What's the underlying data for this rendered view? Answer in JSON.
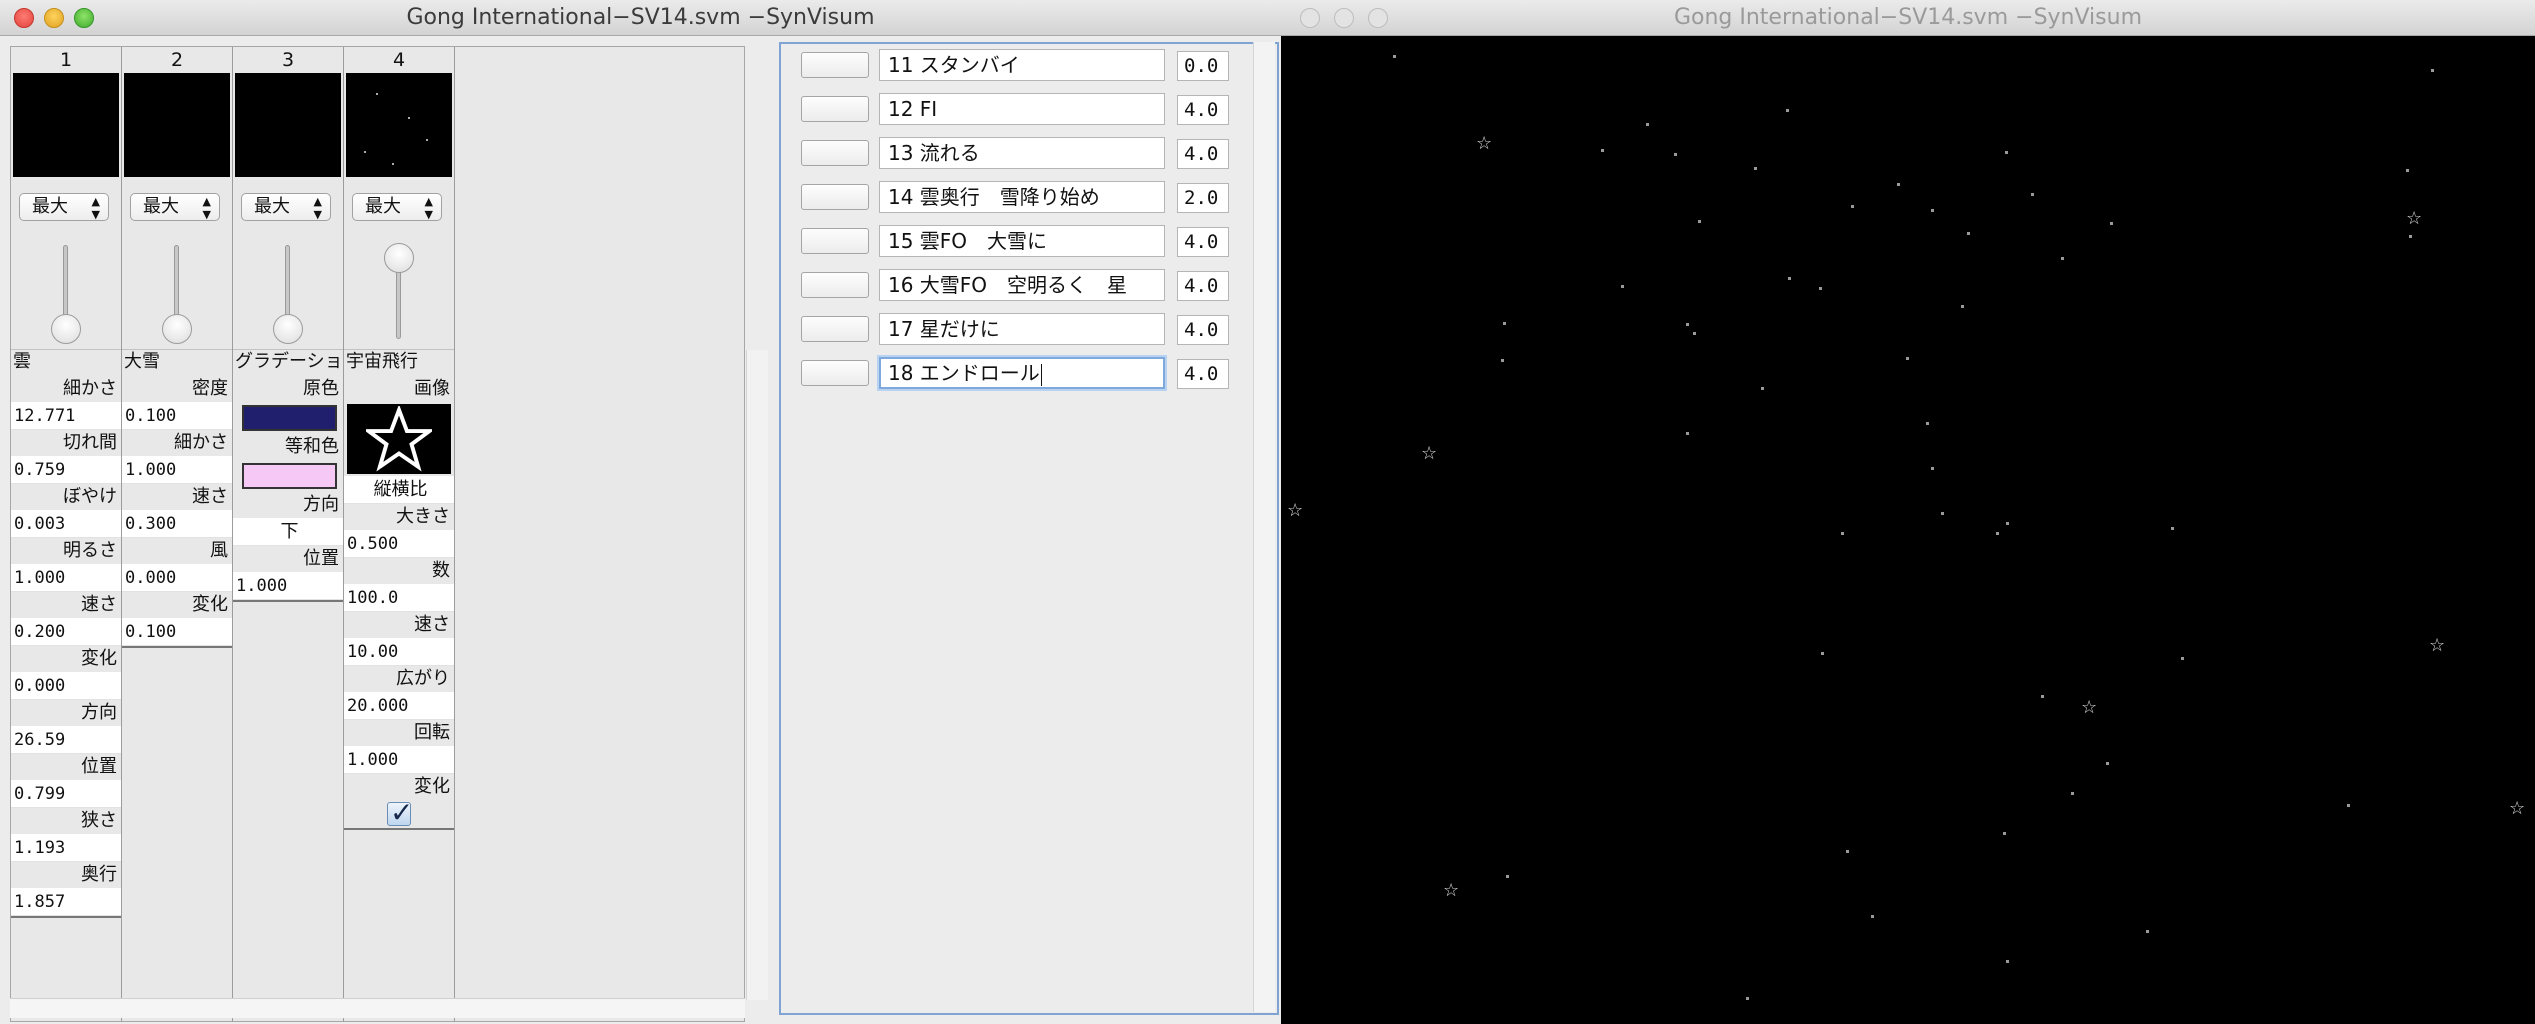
{
  "window_left": {
    "title": "Gong International−SV14.svm −SynVisum"
  },
  "window_right": {
    "title": "Gong International−SV14.svm −SynVisum"
  },
  "layers": [
    {
      "number": "1",
      "mode": "最大",
      "slider_value": 0.0,
      "name": "雲",
      "params": [
        {
          "label": "細かさ",
          "value": "12.771"
        },
        {
          "label": "切れ間",
          "value": "0.759"
        },
        {
          "label": "ぼやけ",
          "value": "0.003"
        },
        {
          "label": "明るさ",
          "value": "1.000"
        },
        {
          "label": "速さ",
          "value": "0.200"
        },
        {
          "label": "変化",
          "value": "0.000"
        },
        {
          "label": "方向",
          "value": "26.59"
        },
        {
          "label": "位置",
          "value": "0.799"
        },
        {
          "label": "狭さ",
          "value": "1.193"
        },
        {
          "label": "奥行",
          "value": "1.857"
        }
      ]
    },
    {
      "number": "2",
      "mode": "最大",
      "slider_value": 0.0,
      "name": "大雪",
      "params": [
        {
          "label": "密度",
          "value": "0.100"
        },
        {
          "label": "細かさ",
          "value": "1.000"
        },
        {
          "label": "速さ",
          "value": "0.300"
        },
        {
          "label": "風",
          "value": "0.000"
        },
        {
          "label": "変化",
          "value": "0.100"
        }
      ]
    },
    {
      "number": "3",
      "mode": "最大",
      "slider_value": 0.0,
      "name": "グラデーショ",
      "params": [
        {
          "label": "原色",
          "color": "#1f1f6e"
        },
        {
          "label": "等和色",
          "color": "#f5c8f5"
        },
        {
          "label": "方向",
          "value": "下"
        },
        {
          "label": "位置",
          "value": "1.000"
        }
      ]
    },
    {
      "number": "4",
      "mode": "最大",
      "slider_value": 1.0,
      "name": "宇宙飛行",
      "image_label": "画像",
      "image_icon": "star-icon",
      "aspect_label": "縦横比",
      "params": [
        {
          "label": "大きさ",
          "value": "0.500"
        },
        {
          "label": "数",
          "value": "100.0"
        },
        {
          "label": "速さ",
          "value": "10.00"
        },
        {
          "label": "広がり",
          "value": "20.000"
        },
        {
          "label": "回転",
          "value": "1.000"
        }
      ],
      "change_label": "変化",
      "change_checked": true
    }
  ],
  "cues": [
    {
      "name": "11 スタンバイ",
      "time": "0.0"
    },
    {
      "name": "12 FI",
      "time": "4.0"
    },
    {
      "name": "13 流れる",
      "time": "4.0"
    },
    {
      "name": "14 雲奥行　雪降り始め",
      "time": "2.0"
    },
    {
      "name": "15 雲FO　大雪に",
      "time": "4.0"
    },
    {
      "name": "16 大雪FO　空明るく　星",
      "time": "4.0"
    },
    {
      "name": "17 星だけに",
      "time": "4.0"
    },
    {
      "name": "18 エンドロール",
      "time": "4.0",
      "focused": true
    }
  ],
  "output": {
    "background": "#000000",
    "particle_color": "#d9d9d9"
  }
}
